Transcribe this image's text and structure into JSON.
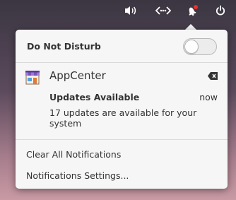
{
  "topbar": {
    "icons": [
      "volume-icon",
      "network-icon",
      "notifications-bell-icon",
      "power-icon"
    ]
  },
  "panel": {
    "dnd_label": "Do Not Disturb",
    "dnd_enabled": false,
    "notification": {
      "app_name": "AppCenter",
      "title": "Updates Available",
      "time": "now",
      "body": "17 updates are available for your system"
    },
    "menu": {
      "clear_all": "Clear All Notifications",
      "settings": "Notifications Settings..."
    }
  },
  "colors": {
    "badge": "#e8322a",
    "panel_bg": "#f6f6f6"
  }
}
